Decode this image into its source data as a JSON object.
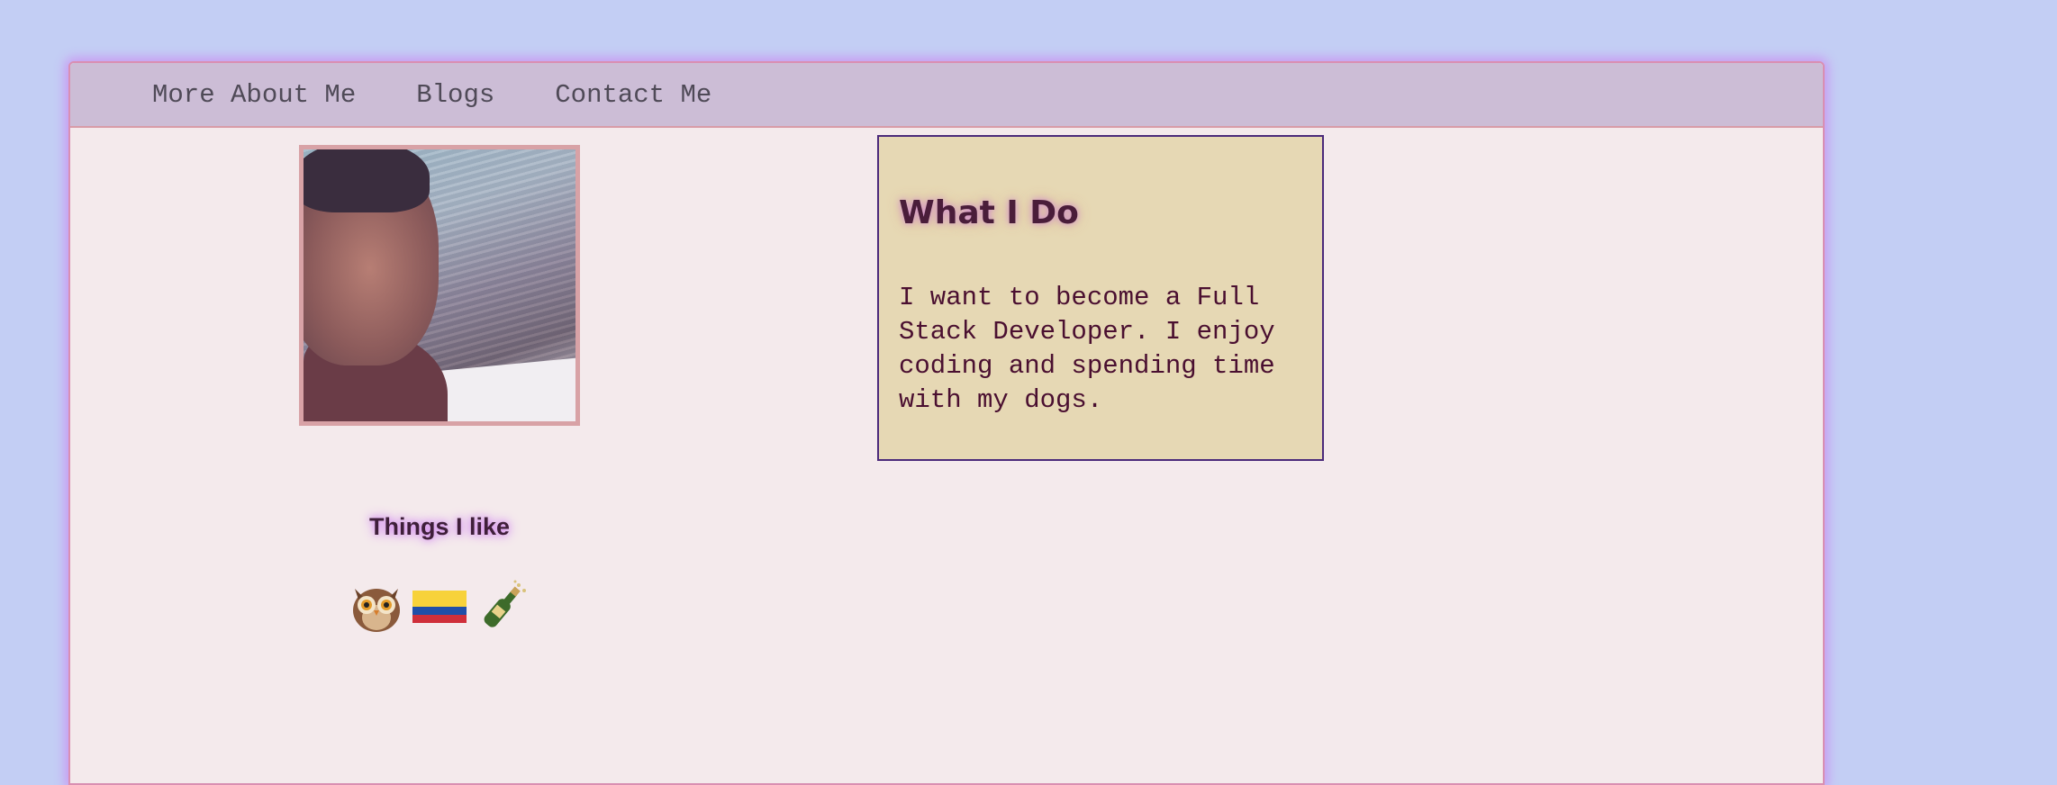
{
  "nav": {
    "items": [
      {
        "label": "More About Me"
      },
      {
        "label": "Blogs"
      },
      {
        "label": "Contact Me"
      }
    ]
  },
  "profile": {
    "things_title": "Things I like",
    "emojis": [
      "owl-icon",
      "colombia-flag-icon",
      "champagne-bottle-icon"
    ]
  },
  "what_i_do": {
    "title": "What I Do",
    "text": "I want to become a Full Stack Developer. I enjoy coding and spending time with my dogs."
  },
  "colors": {
    "page_bg": "#c3cef4",
    "nav_bg": "#ccbdd6",
    "content_bg": "#f4eaec",
    "card_bg": "#e6d8b4",
    "card_text": "#4a0f30"
  }
}
